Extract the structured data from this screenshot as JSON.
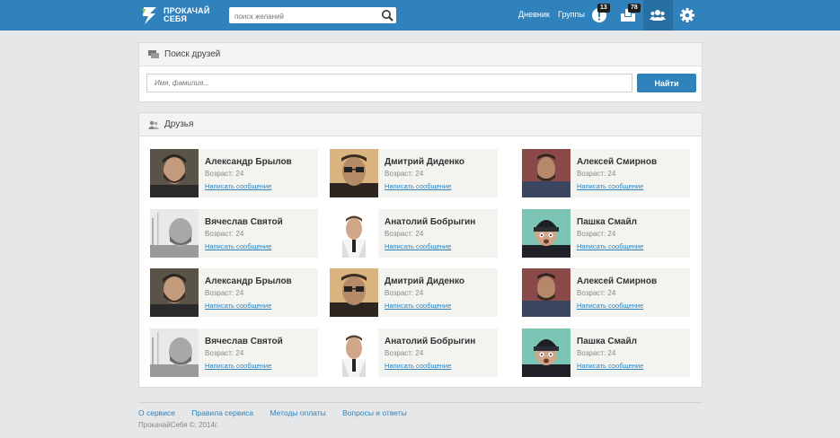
{
  "header": {
    "logo_line1": "ПРОКАЧАЙ",
    "logo_line2": "СЕБЯ",
    "search_placeholder": "поиск желаний",
    "nav": [
      "Дневник",
      "Группы"
    ],
    "badge_notifications": "13",
    "badge_messages": "78",
    "icons": [
      "search-icon",
      "notifications-icon",
      "messages-icon",
      "friends-icon",
      "gear-icon"
    ]
  },
  "search_panel": {
    "title": "Поиск друзей",
    "input_placeholder": "Имя, фамилия...",
    "button_label": "Найти"
  },
  "friends_panel": {
    "title": "Друзья",
    "message_label": "Написать сообщение",
    "friends": [
      {
        "name": "Александр Брылов",
        "age": "Возраст: 24",
        "avatar": "beard"
      },
      {
        "name": "Дмитрий Диденко",
        "age": "Возраст: 24",
        "avatar": "glasses"
      },
      {
        "name": "Алексей Смирнов",
        "age": "Возраст: 24",
        "avatar": "suit"
      },
      {
        "name": "Вячеслав Святой",
        "age": "Возраст: 24",
        "avatar": "bw"
      },
      {
        "name": "Анатолий Бобрыгин",
        "age": "Возраст: 24",
        "avatar": "white"
      },
      {
        "name": "Пашка Смайл",
        "age": "Возраст: 24",
        "avatar": "beanie"
      },
      {
        "name": "Александр Брылов",
        "age": "Возраст: 24",
        "avatar": "beard"
      },
      {
        "name": "Дмитрий Диденко",
        "age": "Возраст: 24",
        "avatar": "glasses"
      },
      {
        "name": "Алексей Смирнов",
        "age": "Возраст: 24",
        "avatar": "suit"
      },
      {
        "name": "Вячеслав Святой",
        "age": "Возраст: 24",
        "avatar": "bw"
      },
      {
        "name": "Анатолий Бобрыгин",
        "age": "Возраст: 24",
        "avatar": "white"
      },
      {
        "name": "Пашка Смайл",
        "age": "Возраст: 24",
        "avatar": "beanie"
      }
    ]
  },
  "footer": {
    "links": [
      "О сервисе",
      "Правила сервиса",
      "Методы оплаты",
      "Вопросы и ответы"
    ],
    "copyright": "ПрокачайСебя ©, 2014г."
  },
  "colors": {
    "header": "#2f82bc",
    "accent": "#2f82bc",
    "card_bg": "#f3f3ef",
    "page_bg": "#e6e7e8"
  }
}
